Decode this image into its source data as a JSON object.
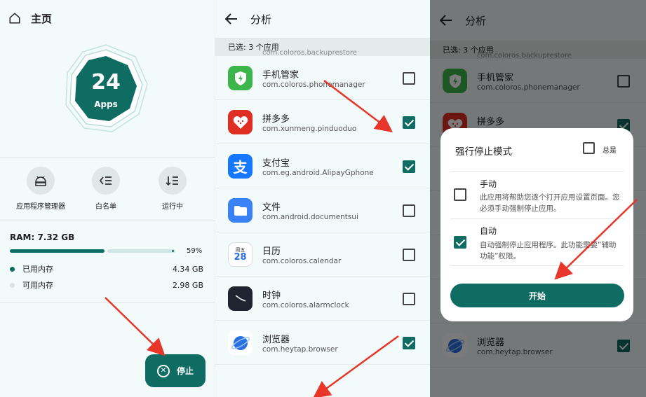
{
  "home": {
    "title": "主页",
    "apps_count": "24",
    "apps_label": "Apps",
    "shortcuts": [
      {
        "label": "应用程序管理器"
      },
      {
        "label": "白名单"
      },
      {
        "label": "运行中"
      }
    ],
    "ram": {
      "title": "RAM: 7.32 GB",
      "percent_label": "59%",
      "used_fraction": 0.59,
      "used_label": "已用内存",
      "used_value": "4.34 GB",
      "free_label": "可用内存",
      "free_value": "2.98 GB"
    },
    "stop_button": "停止"
  },
  "analysis": {
    "title": "分析",
    "selected": "已选: 3 个应用",
    "ghost_package": "com.coloros.backuprestore",
    "apps": [
      {
        "name": "手机管家",
        "package": "com.coloros.phonemanager",
        "checked": false,
        "icon": "shield-icon",
        "color": "#3cb54a"
      },
      {
        "name": "拼多多",
        "package": "com.xunmeng.pinduoduo",
        "checked": true,
        "icon": "pinduoduo-icon",
        "color": "#e02e24"
      },
      {
        "name": "支付宝",
        "package": "com.eg.android.AlipayGphone",
        "checked": true,
        "icon": "alipay-icon",
        "color": "#1677ff"
      },
      {
        "name": "文件",
        "package": "com.android.documentsui",
        "checked": false,
        "icon": "folder-icon",
        "color": "#3b82f6"
      },
      {
        "name": "日历",
        "package": "com.coloros.calendar",
        "checked": false,
        "icon": "calendar-icon",
        "color": "#ffffff"
      },
      {
        "name": "时钟",
        "package": "com.coloros.alarmclock",
        "checked": false,
        "icon": "clock-icon",
        "color": "#1e2430"
      },
      {
        "name": "浏览器",
        "package": "com.heytap.browser",
        "checked": true,
        "icon": "browser-icon",
        "color": "#ffffff"
      }
    ],
    "calendar_weekday": "周五",
    "calendar_day": "28"
  },
  "dialog": {
    "title": "强行停止模式",
    "always_label": "总是",
    "manual_title": "手动",
    "manual_desc": "此应用将帮助您逐个打开应用设置页面。您必须手动强制停止应用。",
    "auto_title": "自动",
    "auto_desc": "自动强制停止应用程序。此功能需要“辅助功能”权限。",
    "start_button": "开始"
  },
  "colors": {
    "accent": "#0f6c63",
    "arrow": "#e8352a"
  }
}
